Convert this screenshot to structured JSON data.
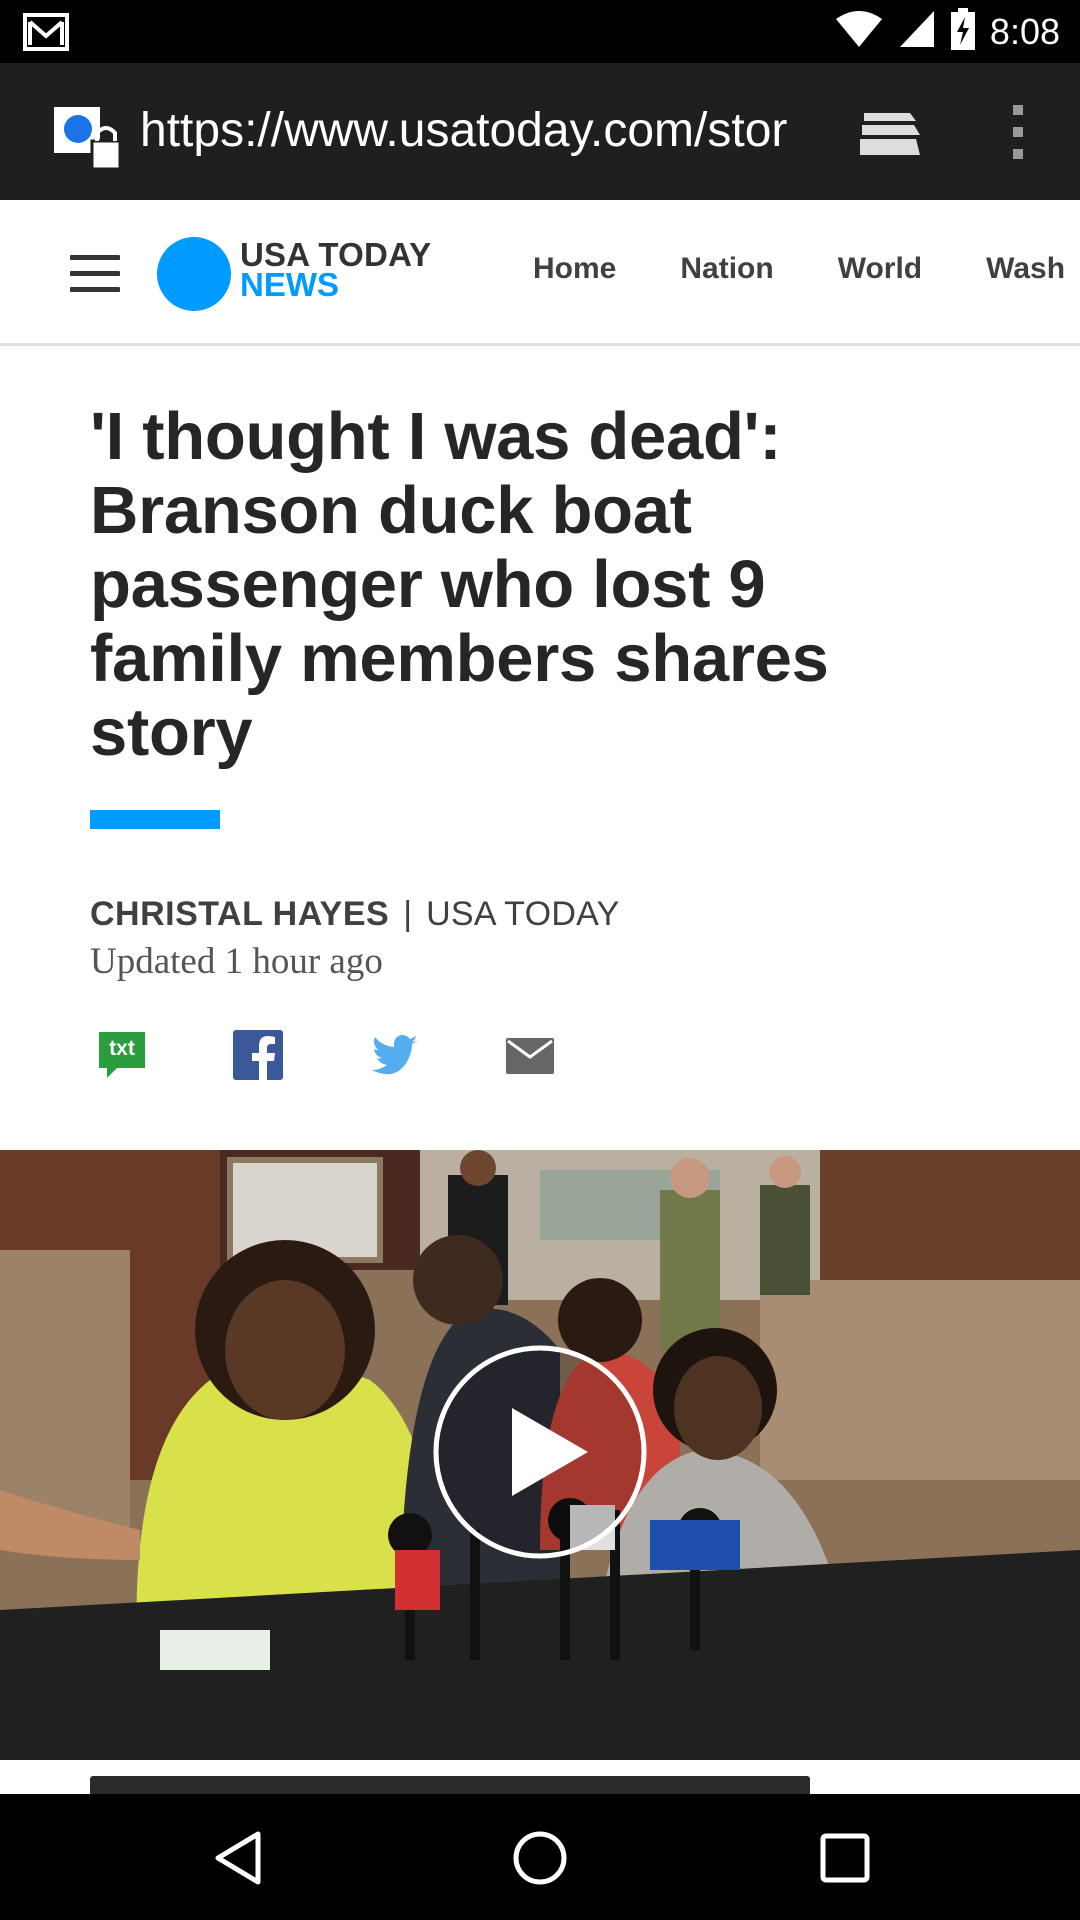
{
  "status_bar": {
    "time": "8:08"
  },
  "browser": {
    "url": "https://www.usatoday.com/stor"
  },
  "site": {
    "logo_line1": "USA TODAY",
    "logo_line2": "NEWS",
    "nav": [
      "Home",
      "Nation",
      "World",
      "Wash"
    ]
  },
  "article": {
    "headline": "'I thought I was dead': Branson duck boat passenger who lost 9 family members shares story",
    "author": "CHRISTAL HAYES",
    "separator": "|",
    "publication": "USA TODAY",
    "updated": "Updated 1 hour ago",
    "share_txt_label": "txt"
  },
  "colors": {
    "accent": "#009bff",
    "txt_share": "#2a9d3e",
    "facebook": "#3b5998",
    "twitter": "#55acee",
    "email": "#666666"
  },
  "icons": [
    "gmail-icon",
    "wifi-icon",
    "signal-icon",
    "battery-charging-icon",
    "lock-icon",
    "tab-switcher-icon",
    "overflow-menu-icon",
    "hamburger-menu-icon",
    "txt-share-icon",
    "facebook-icon",
    "twitter-icon",
    "email-icon",
    "play-icon",
    "back-icon",
    "home-icon",
    "recents-icon"
  ]
}
